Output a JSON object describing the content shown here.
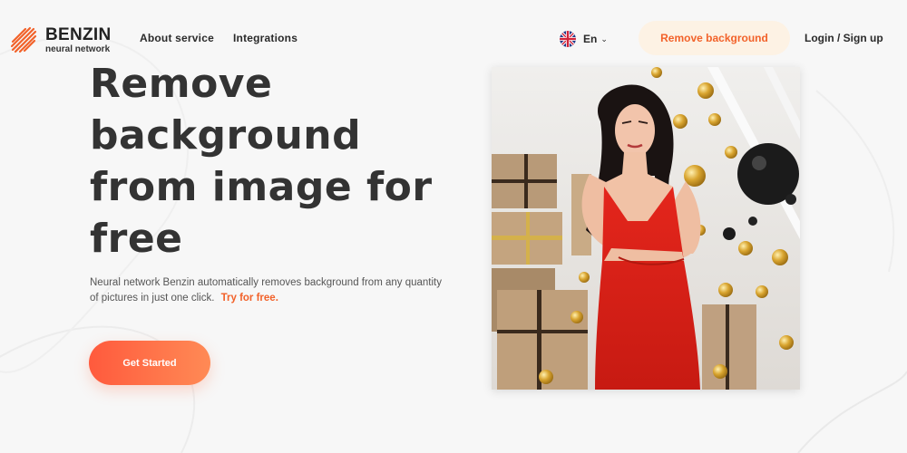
{
  "brand": {
    "name": "BENZIN",
    "subtitle": "neural network"
  },
  "nav": {
    "about": "About service",
    "integrations": "Integrations",
    "language": "En",
    "remove_button": "Remove background",
    "login": "Login / Sign up"
  },
  "hero": {
    "title": "Remove background from image for free",
    "description": "Neural network Benzin automatically removes background from any quantity of pictures in just one click.",
    "try_link": "Try for free.",
    "cta": "Get Started"
  },
  "icons": {
    "logo": "benzin-logo-icon",
    "flag": "uk-flag-icon",
    "chevron": "chevron-down-icon"
  },
  "colors": {
    "accent": "#f2622a",
    "cta_gradient_start": "#ff5a3d",
    "cta_gradient_end": "#ff8a55",
    "remove_button_bg": "#fdf2e4",
    "text_dark": "#333333",
    "background": "#f7f7f7"
  }
}
